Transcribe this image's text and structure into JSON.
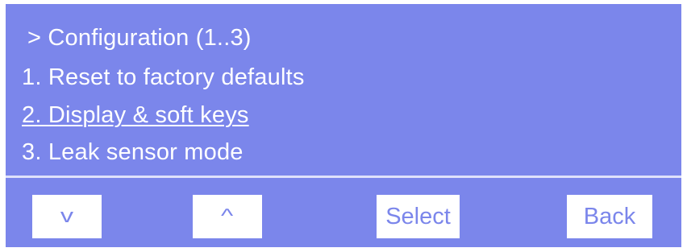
{
  "display": {
    "header": "> Configuration (1..3)",
    "items": [
      {
        "label": "1. Reset to factory defaults",
        "selected": false
      },
      {
        "label": "2. Display & soft keys",
        "selected": true
      },
      {
        "label": "3. Leak sensor mode",
        "selected": false
      }
    ]
  },
  "softkeys": {
    "down": {
      "glyph": "v",
      "icon": "chevron-down-icon"
    },
    "up": {
      "glyph": "^",
      "icon": "chevron-up-icon"
    },
    "select": {
      "label": "Select"
    },
    "back": {
      "label": "Back"
    }
  },
  "colors": {
    "screen_background": "#7b86eb",
    "text": "#ffffff",
    "divider": "#dfe2fb",
    "softkey_background": "#ffffff",
    "softkey_text": "#7b86eb"
  }
}
